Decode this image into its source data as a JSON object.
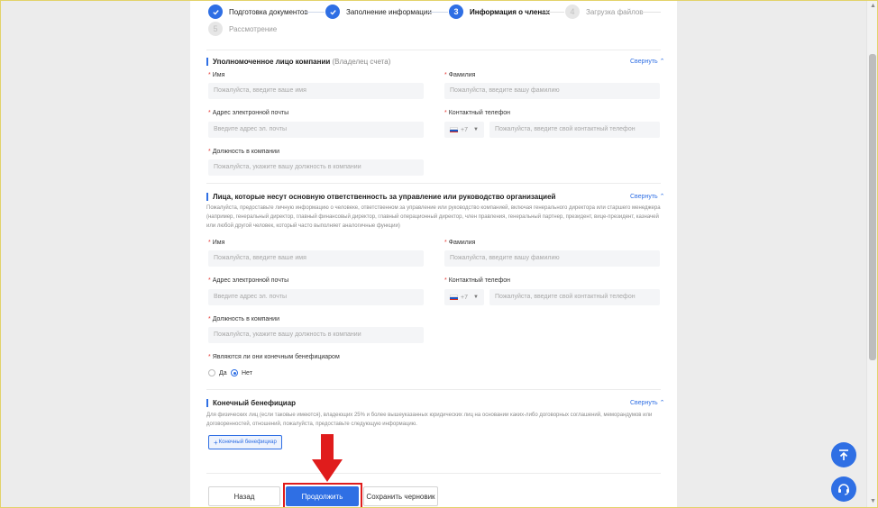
{
  "steps": [
    {
      "label": "Подготовка документов",
      "state": "done"
    },
    {
      "label": "Заполнение информации",
      "state": "done"
    },
    {
      "label": "Информация о членах",
      "number": "3",
      "state": "active"
    },
    {
      "label": "Загрузка файлов",
      "number": "4",
      "state": "todo"
    },
    {
      "label": "Рассмотрение",
      "number": "5",
      "state": "todo"
    }
  ],
  "collapse_label": "Свернуть",
  "section1": {
    "title": "Уполномоченное лицо компании",
    "subtitle": "(Владелец счета)",
    "first_name_label": "Имя",
    "first_name_placeholder": "Пожалуйста, введите ваше имя",
    "last_name_label": "Фамилия",
    "last_name_placeholder": "Пожалуйста, введите вашу фамилию",
    "email_label": "Адрес электронной почты",
    "email_placeholder": "Введите адрес эл. почты",
    "phone_label": "Контактный телефон",
    "phone_code": "+7",
    "phone_placeholder": "Пожалуйста, введите свой контактный телефон",
    "position_label": "Должность в компании",
    "position_placeholder": "Пожалуйста, укажите вашу должность в компании"
  },
  "section2": {
    "title": "Лица, которые несут основную ответственность за управление или руководство организацией",
    "description": "Пожалуйста, предоставьте личную информацию о человеке, ответственном за управление или руководство компанией, включая генерального директора или старшего менеджера (например, генеральный директор, главный финансовый директор, главный операционный директор, член правления, генеральный партнер, президент, вице-президент, казначей или любой другой человек, который часто выполняет аналогичные функции)",
    "first_name_label": "Имя",
    "first_name_placeholder": "Пожалуйста, введите ваше имя",
    "last_name_label": "Фамилия",
    "last_name_placeholder": "Пожалуйста, введите вашу фамилию",
    "email_label": "Адрес электронной почты",
    "email_placeholder": "Введите адрес эл. почты",
    "phone_label": "Контактный телефон",
    "phone_code": "+7",
    "phone_placeholder": "Пожалуйста, введите свой контактный телефон",
    "position_label": "Должность в компании",
    "position_placeholder": "Пожалуйста, укажите вашу должность в компании",
    "beneficiary_question": "Являются ли они конечным бенефициаром",
    "option_yes": "Да",
    "option_no": "Нет",
    "selected": "Нет"
  },
  "section3": {
    "title": "Конечный бенефициар",
    "description": "Для физических лиц (если таковые имеются), владеющих 25% и более вышеуказанных юридических лиц на основании каких-либо договорных соглашений, меморандумов или договоренностей, отношений, пожалуйста, предоставьте следующую информацию.",
    "add_button": "Конечный бенефициар"
  },
  "buttons": {
    "back": "Назад",
    "continue": "Продолжить",
    "save_draft": "Сохранить черновик"
  },
  "colors": {
    "accent": "#2f6fe4",
    "annotation": "#e01c1c"
  }
}
